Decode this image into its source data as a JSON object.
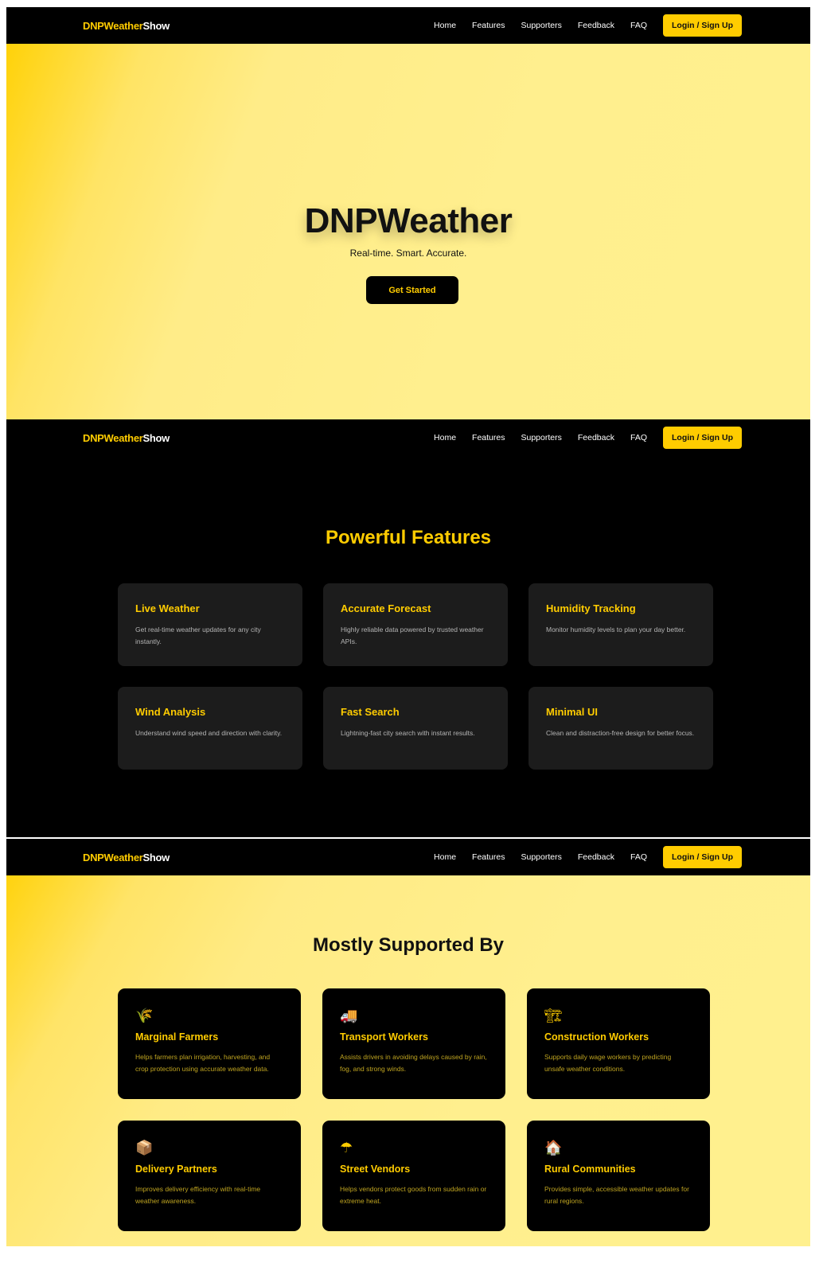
{
  "nav": {
    "brand_a": "DNPWeather",
    "brand_b": "Show",
    "items": [
      "Home",
      "Features",
      "Supporters",
      "Feedback",
      "FAQ"
    ],
    "login": "Login / Sign Up"
  },
  "hero": {
    "title": "DNPWeather",
    "subtitle": "Real-time. Smart. Accurate.",
    "cta": "Get Started"
  },
  "features": {
    "title": "Powerful Features",
    "cards": [
      {
        "title": "Live Weather",
        "desc": "Get real-time weather updates for any city instantly."
      },
      {
        "title": "Accurate Forecast",
        "desc": "Highly reliable data powered by trusted weather APIs."
      },
      {
        "title": "Humidity Tracking",
        "desc": "Monitor humidity levels to plan your day better."
      },
      {
        "title": "Wind Analysis",
        "desc": "Understand wind speed and direction with clarity."
      },
      {
        "title": "Fast Search",
        "desc": "Lightning-fast city search with instant results."
      },
      {
        "title": "Minimal UI",
        "desc": "Clean and distraction-free design for better focus."
      }
    ]
  },
  "supporters": {
    "title": "Mostly Supported By",
    "cards": [
      {
        "icon": "🌾",
        "title": "Marginal Farmers",
        "desc": "Helps farmers plan irrigation, harvesting, and crop protection using accurate weather data."
      },
      {
        "icon": "🚚",
        "title": "Transport Workers",
        "desc": "Assists drivers in avoiding delays caused by rain, fog, and strong winds."
      },
      {
        "icon": "🏗",
        "title": "Construction Workers",
        "desc": "Supports daily wage workers by predicting unsafe weather conditions."
      },
      {
        "icon": "📦",
        "title": "Delivery Partners",
        "desc": "Improves delivery efficiency with real-time weather awareness."
      },
      {
        "icon": "☂",
        "title": "Street Vendors",
        "desc": "Helps vendors protect goods from sudden rain or extreme heat."
      },
      {
        "icon": "🏠",
        "title": "Rural Communities",
        "desc": "Provides simple, accessible weather updates for rural regions."
      }
    ]
  }
}
